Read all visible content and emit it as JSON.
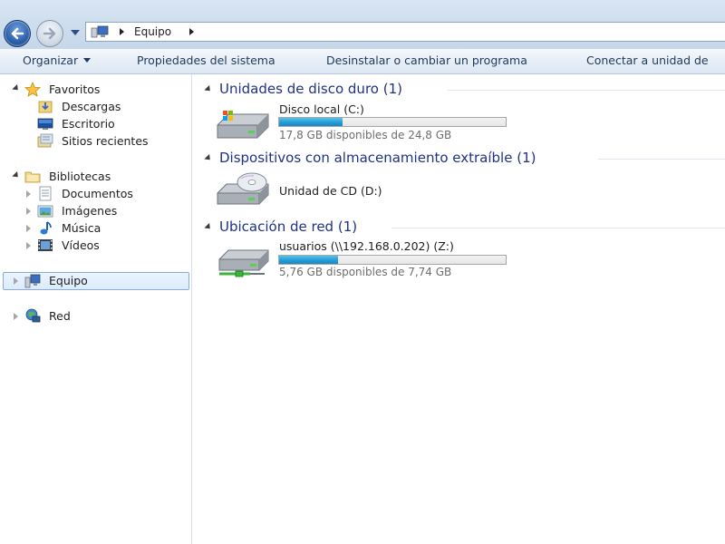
{
  "address_bar": {
    "crumbs": [
      "Equipo"
    ]
  },
  "toolbar": {
    "organize": "Organizar",
    "system_properties": "Propiedades del sistema",
    "uninstall": "Desinstalar o cambiar un programa",
    "map_drive": "Conectar a unidad de"
  },
  "nav": {
    "favorites": "Favoritos",
    "favorites_items": [
      "Descargas",
      "Escritorio",
      "Sitios recientes"
    ],
    "libraries": "Bibliotecas",
    "libraries_items": [
      "Documentos",
      "Imágenes",
      "Música",
      "Vídeos"
    ],
    "computer": "Equipo",
    "network": "Red"
  },
  "content": {
    "groups": [
      {
        "title": "Unidades de disco duro (1)",
        "items": [
          {
            "name": "Disco local (C:)",
            "free_text": "17,8 GB disponibles de 24,8 GB",
            "used_fraction": 0.28,
            "icon": "hard-disk-icon"
          }
        ]
      },
      {
        "title": "Dispositivos con almacenamiento extraíble (1)",
        "items": [
          {
            "name": "Unidad de CD (D:)",
            "icon": "cd-drive-icon"
          }
        ]
      },
      {
        "title": "Ubicación de red (1)",
        "items": [
          {
            "name": "usuarios (\\\\192.168.0.202) (Z:)",
            "free_text": "5,76 GB disponibles de 7,74 GB",
            "used_fraction": 0.26,
            "icon": "network-drive-icon"
          }
        ]
      }
    ]
  },
  "colors": {
    "group_title": "#1e3287",
    "bar_fill": "#26a0da",
    "selection": "#dcebfc"
  }
}
